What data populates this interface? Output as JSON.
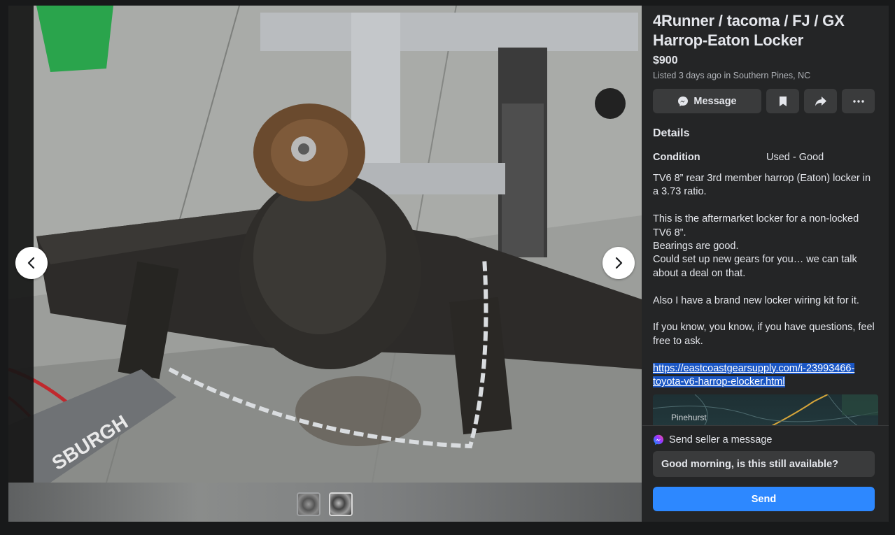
{
  "listing": {
    "title_line1": "4Runner / tacoma / FJ / GX",
    "title_line2": "Harrop-Eaton Locker",
    "price": "$900",
    "listed": "Listed 3 days ago in Southern Pines, NC"
  },
  "actions": {
    "message_label": "Message",
    "save_icon": "bookmark-icon",
    "share_icon": "share-icon",
    "more_icon": "more-icon"
  },
  "details": {
    "heading": "Details",
    "condition_label": "Condition",
    "condition_value": "Used - Good",
    "description": {
      "p1": "TV6 8” rear 3rd member harrop (Eaton) locker in a 3.73 ratio.",
      "p2a": "This is the aftermarket locker for a non-locked TV6 8”.",
      "p2b": "Bearings are good.",
      "p2c": "Could set up new gears for you… we can talk about a deal on that.",
      "p3": "Also I have a brand new locker wiring kit for it.",
      "p4": "If you know, you know, if you have questions, feel free to ask.",
      "link": "https://eastcoastgearsupply.com/i-23993466-toyota-v6-harrop-elocker.html"
    },
    "map_label": "Pinehurst"
  },
  "messenger": {
    "heading": "Send seller a message",
    "input_value": "Good morning, is this still available?",
    "send_label": "Send"
  },
  "colors": {
    "accent": "#2d88ff",
    "panel_bg": "#242526",
    "button_bg": "#3a3b3c",
    "link_highlight": "#1a56c4"
  }
}
